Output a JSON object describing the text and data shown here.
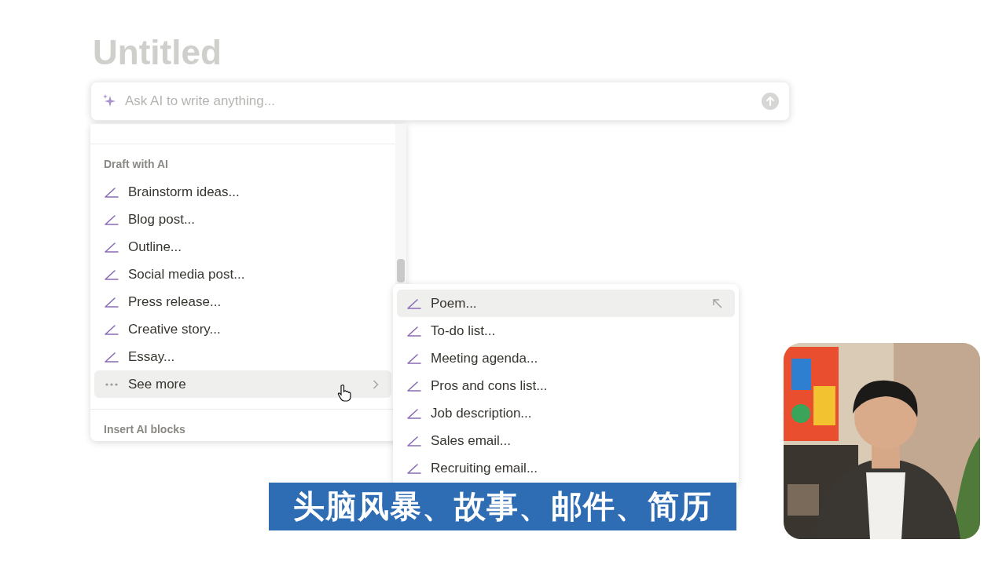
{
  "page": {
    "title": "Untitled"
  },
  "ai_prompt": {
    "placeholder": "Ask AI to write anything..."
  },
  "menu": {
    "heading": "Draft with AI",
    "items": [
      {
        "label": "Brainstorm ideas...",
        "kind": "draft",
        "selected": false
      },
      {
        "label": "Blog post...",
        "kind": "draft",
        "selected": false
      },
      {
        "label": "Outline...",
        "kind": "draft",
        "selected": false
      },
      {
        "label": "Social media post...",
        "kind": "draft",
        "selected": false
      },
      {
        "label": "Press release...",
        "kind": "draft",
        "selected": false
      },
      {
        "label": "Creative story...",
        "kind": "draft",
        "selected": false
      },
      {
        "label": "Essay...",
        "kind": "draft",
        "selected": false
      },
      {
        "label": "See more",
        "kind": "more",
        "selected": true
      }
    ],
    "next_heading": "Insert AI blocks"
  },
  "submenu": {
    "items": [
      {
        "label": "Poem...",
        "selected": true
      },
      {
        "label": "To-do list...",
        "selected": false
      },
      {
        "label": "Meeting agenda...",
        "selected": false
      },
      {
        "label": "Pros and cons list...",
        "selected": false
      },
      {
        "label": "Job description...",
        "selected": false
      },
      {
        "label": "Sales email...",
        "selected": false
      },
      {
        "label": "Recruiting email...",
        "selected": false
      }
    ]
  },
  "subtitle": "头脑风暴、故事、邮件、简历"
}
